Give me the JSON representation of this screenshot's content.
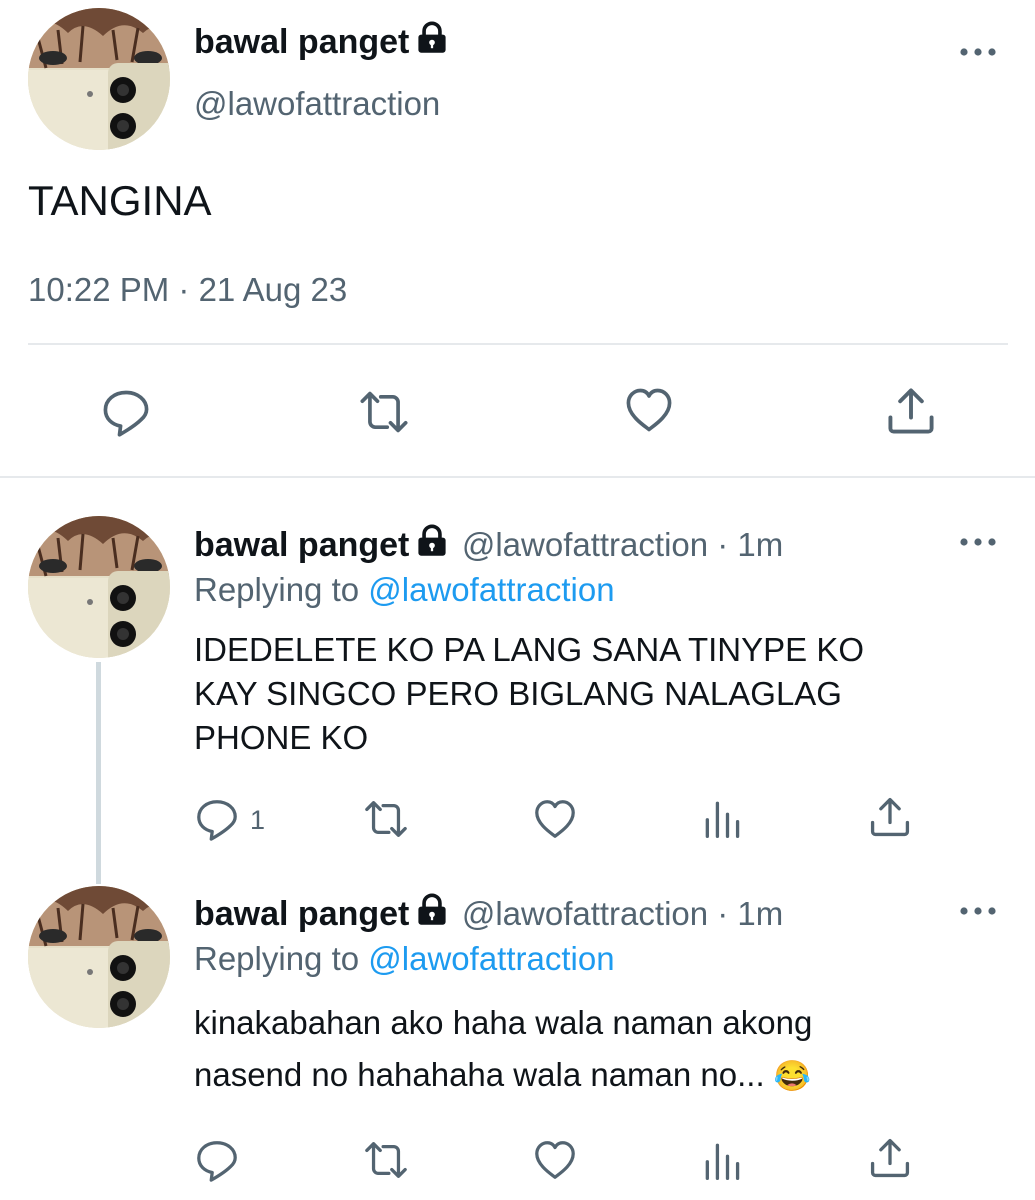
{
  "main_tweet": {
    "display_name": "bawal panget",
    "handle": "@lawofattraction",
    "text": "TANGINA",
    "timestamp": "10:22 PM · 21 Aug 23"
  },
  "replies": [
    {
      "display_name": "bawal panget",
      "handle_time": "@lawofattraction · 1m",
      "replying_prefix": "Replying to",
      "replying_to": "@lawofattraction",
      "text_line1": "IDEDELETE KO PA LANG SANA TINYPE KO",
      "text_line2": "KAY SINGCO PERO BIGLANG NALAGLAG",
      "text_line3": "PHONE KO",
      "reply_count": "1"
    },
    {
      "display_name": "bawal panget",
      "handle_time": "@lawofattraction · 1m",
      "replying_prefix": "Replying to",
      "replying_to": "@lawofattraction",
      "text_line1": "kinakabahan ako haha wala naman akong",
      "text_line2": "nasend no hahahaha wala naman no...",
      "emoji": "😂"
    }
  ],
  "icons": [
    "reply-icon",
    "retweet-icon",
    "like-icon",
    "share-icon",
    "views-icon",
    "more-icon",
    "lock-icon"
  ],
  "colors": {
    "text": "#0f1419",
    "secondary": "#536471",
    "link": "#1d9bf0",
    "divider": "#e6e9ec"
  }
}
